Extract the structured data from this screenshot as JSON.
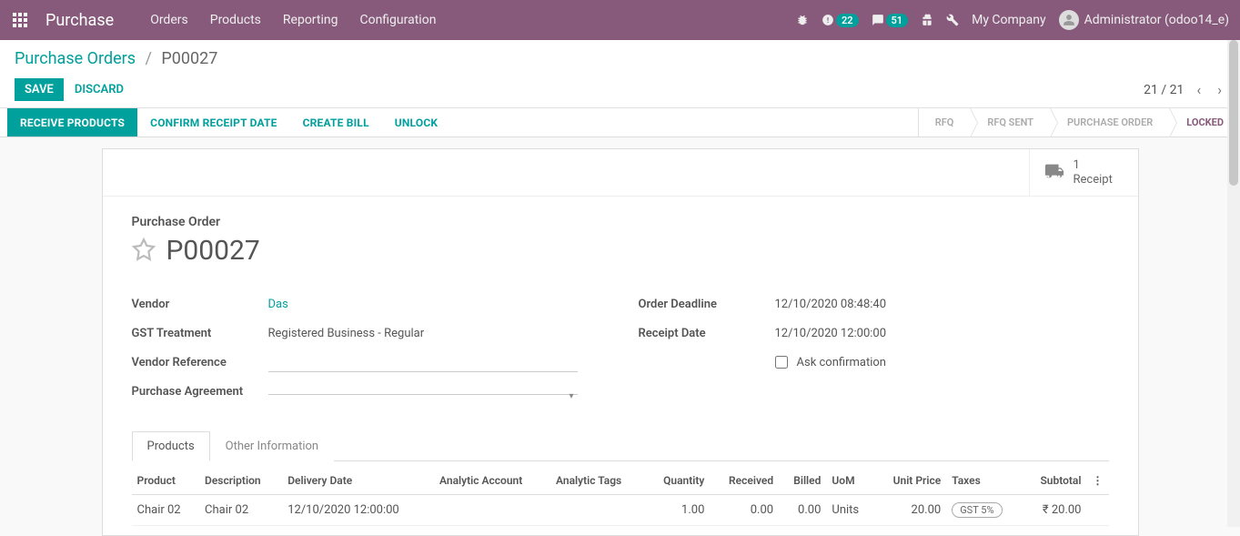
{
  "topbar": {
    "app_title": "Purchase",
    "menu": [
      "Orders",
      "Products",
      "Reporting",
      "Configuration"
    ],
    "activities_count": "22",
    "messages_count": "51",
    "company": "My Company",
    "user": "Administrator (odoo14_e)"
  },
  "breadcrumb": {
    "parent": "Purchase Orders",
    "current": "P00027"
  },
  "cp": {
    "save": "Save",
    "discard": "Discard",
    "pager": "21 / 21"
  },
  "statusbar": {
    "actions": [
      "Receive Products",
      "Confirm Receipt Date",
      "Create Bill",
      "Unlock"
    ],
    "steps": [
      "RFQ",
      "RFQ Sent",
      "Purchase Order",
      "Locked"
    ],
    "active_step": 3
  },
  "stat_button": {
    "count": "1",
    "label": "Receipt"
  },
  "form": {
    "subtitle": "Purchase Order",
    "name": "P00027",
    "left": {
      "vendor_label": "Vendor",
      "vendor_value": "Das",
      "gst_label": "GST Treatment",
      "gst_value": "Registered Business - Regular",
      "ref_label": "Vendor Reference",
      "ref_value": "",
      "agreement_label": "Purchase Agreement",
      "agreement_value": ""
    },
    "right": {
      "deadline_label": "Order Deadline",
      "deadline_value": "12/10/2020 08:48:40",
      "receipt_label": "Receipt Date",
      "receipt_value": "12/10/2020 12:00:00",
      "ask_label": "Ask confirmation",
      "ask_checked": false
    }
  },
  "notebook": {
    "tabs": [
      "Products",
      "Other Information"
    ],
    "active": 0
  },
  "table": {
    "headers": {
      "product": "Product",
      "description": "Description",
      "delivery": "Delivery Date",
      "analytic_account": "Analytic Account",
      "analytic_tags": "Analytic Tags",
      "quantity": "Quantity",
      "received": "Received",
      "billed": "Billed",
      "uom": "UoM",
      "unit_price": "Unit Price",
      "taxes": "Taxes",
      "subtotal": "Subtotal"
    },
    "rows": [
      {
        "product": "Chair 02",
        "description": "Chair 02",
        "delivery": "12/10/2020 12:00:00",
        "analytic_account": "",
        "analytic_tags": "",
        "quantity": "1.00",
        "received": "0.00",
        "billed": "0.00",
        "uom": "Units",
        "unit_price": "20.00",
        "taxes": "GST 5%",
        "subtotal": "₹ 20.00"
      }
    ]
  }
}
